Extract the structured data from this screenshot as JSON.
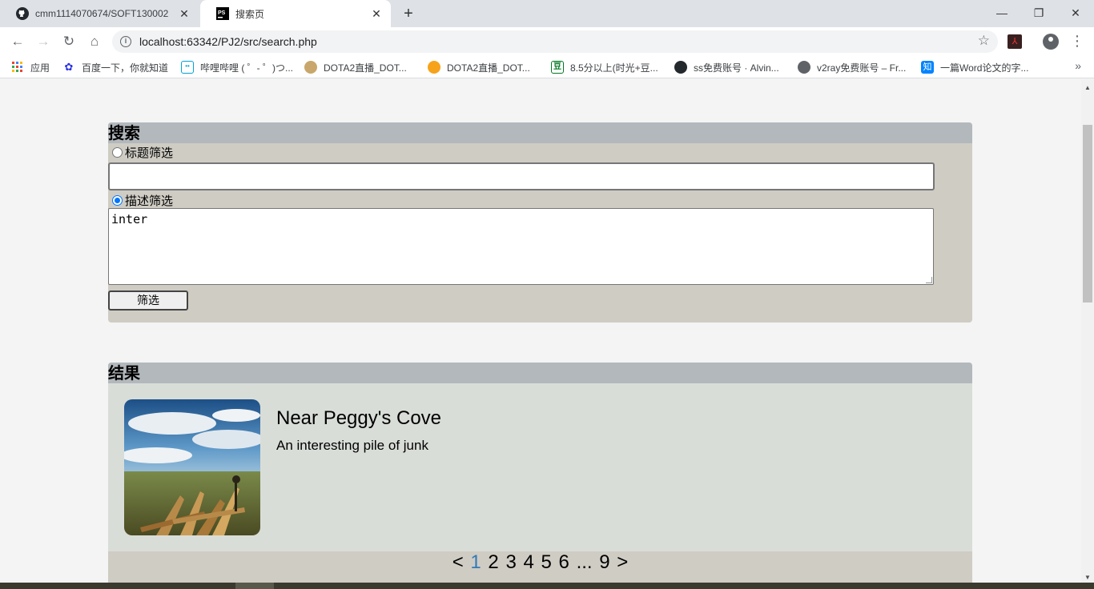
{
  "tabs": [
    {
      "title": "cmm1114070674/SOFT130002",
      "icon": "github-icon"
    },
    {
      "title": "搜索页",
      "icon": "phpstorm-icon"
    }
  ],
  "toolbar": {
    "url": "localhost:63342/PJ2/src/search.php"
  },
  "bookmarks": [
    {
      "label": "应用",
      "icon": "apps-grid-icon"
    },
    {
      "label": "百度一下，你就知道",
      "icon": "baidu-paw-icon"
    },
    {
      "label": "哔哩哔哩 ( ゜- ゜)つ...",
      "icon": "bilibili-icon"
    },
    {
      "label": "DOTA2直播_DOT...",
      "icon": "dota-icon"
    },
    {
      "label": "DOTA2直播_DOT...",
      "icon": "douyu-icon"
    },
    {
      "label": "8.5分以上(时光+豆...",
      "icon": "douban-icon"
    },
    {
      "label": "ss免费账号 · Alvin...",
      "icon": "github-icon"
    },
    {
      "label": "v2ray免费账号 – Fr...",
      "icon": "globe-icon"
    },
    {
      "label": "一篇Word论文的字...",
      "icon": "zhihu-icon"
    }
  ],
  "search": {
    "heading": "搜索",
    "title_filter_label": "标题筛选",
    "title_value": "",
    "desc_filter_label": "描述筛选",
    "desc_value": "inter",
    "filter_button": "筛选",
    "selected_filter": "描述筛选"
  },
  "results": {
    "heading": "结果",
    "items": [
      {
        "title": "Near Peggy's Cove",
        "description": "An interesting pile of junk"
      }
    ],
    "pagination": [
      "<",
      "1",
      "2",
      "3",
      "4",
      "5",
      "6",
      "...",
      "9",
      ">"
    ],
    "current_page": "1"
  }
}
